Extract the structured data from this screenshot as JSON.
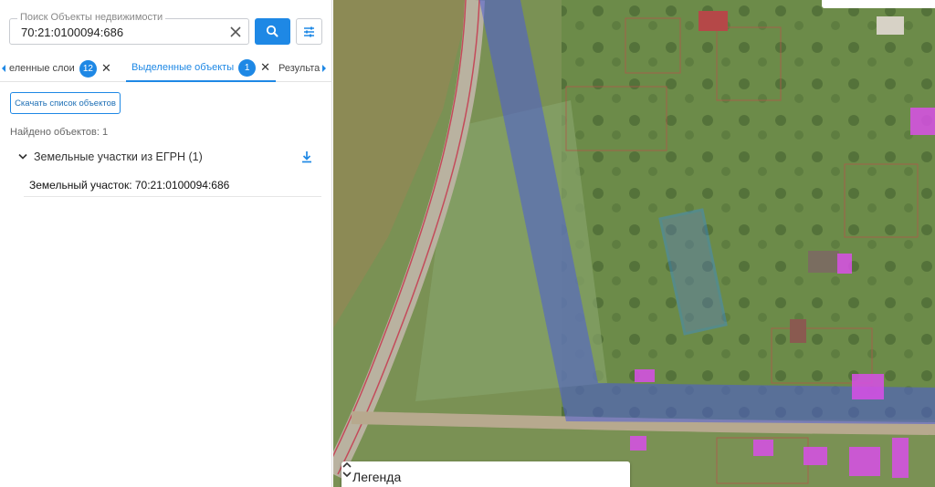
{
  "search": {
    "label": "Поиск Объекты недвижимости",
    "value": "70:21:0100094:686"
  },
  "icons": {
    "clear": "close-icon",
    "search": "search-icon",
    "filter": "tune-icon",
    "download": "download-icon",
    "expand": "chevron-down-icon",
    "legend_toggle": "unfold-icon"
  },
  "tabs": [
    {
      "label": "еленные слои",
      "count": "12"
    },
    {
      "label": "Выделенные объекты",
      "count": "1"
    },
    {
      "label": "Результа"
    }
  ],
  "results": {
    "download_button": "Скачать список объектов",
    "found_text": "Найдено объектов: 1",
    "group_label": "Земельные участки из ЕГРН (1)",
    "items": [
      {
        "label": "Земельный участок: 70:21:0100094:686"
      }
    ]
  },
  "map": {
    "legend_label": "Легенда"
  },
  "colors": {
    "accent": "#1e88e5",
    "zone_overlay": "#4a5bd8",
    "selected_parcel": "#2f8cff",
    "highlighted_buildings": "#d94fe8"
  }
}
